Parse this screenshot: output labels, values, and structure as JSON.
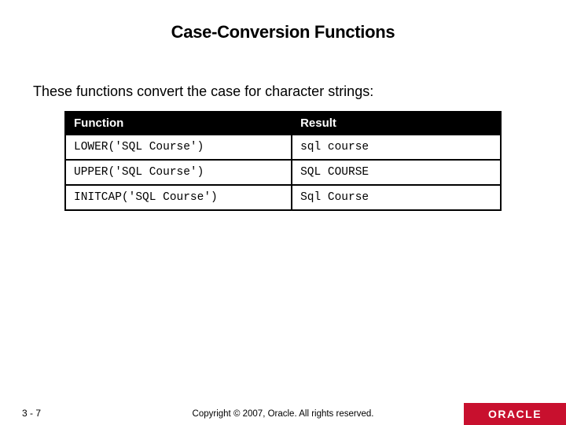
{
  "title": "Case-Conversion Functions",
  "intro": "These functions convert the case for character strings:",
  "table": {
    "headers": {
      "function": "Function",
      "result": "Result"
    },
    "rows": [
      {
        "fn": "LOWER('SQL Course')",
        "res": "sql course"
      },
      {
        "fn": "UPPER('SQL Course')",
        "res": "SQL COURSE"
      },
      {
        "fn": "INITCAP('SQL Course')",
        "res": "Sql Course"
      }
    ]
  },
  "footer": {
    "page": "3 - 7",
    "copyright": "Copyright © 2007, Oracle. All rights reserved.",
    "logo": "ORACLE"
  }
}
